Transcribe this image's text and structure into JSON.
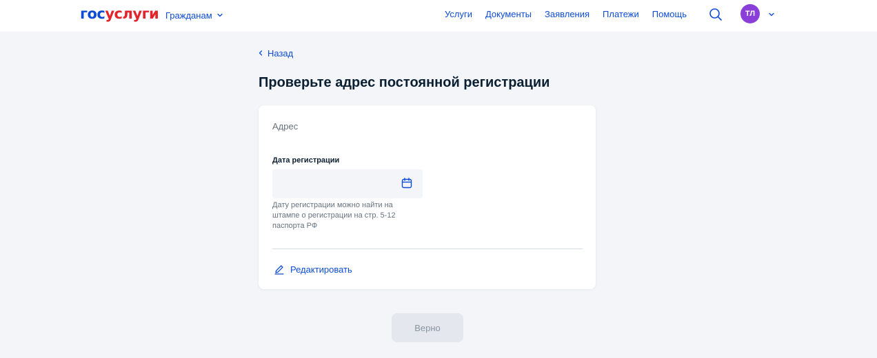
{
  "header": {
    "logo_part1": "гос",
    "logo_part2": "услуги",
    "audience": "Гражданам",
    "nav": [
      "Услуги",
      "Документы",
      "Заявления",
      "Платежи",
      "Помощь"
    ],
    "avatar_initials": "ТЛ"
  },
  "back_label": "Назад",
  "page_title": "Проверьте адрес постоянной регистрации",
  "card": {
    "address_label": "Адрес",
    "date_label": "Дата регистрации",
    "date_value": "",
    "date_hint": "Дату регистрации можно найти на штампе о регистрации на стр. 5-12 паспорта РФ",
    "edit_label": "Редактировать"
  },
  "submit_label": "Верно",
  "colors": {
    "brand_blue": "#0d4cd3",
    "brand_red": "#e3242b",
    "avatar": "#8b3fd9",
    "background": "#f3f5f9"
  },
  "icons": {
    "audience": "chevron-down-icon",
    "search": "search-icon",
    "profile": "chevron-down-icon",
    "back": "chevron-left-icon",
    "date": "calendar-icon",
    "edit": "pencil-icon"
  }
}
